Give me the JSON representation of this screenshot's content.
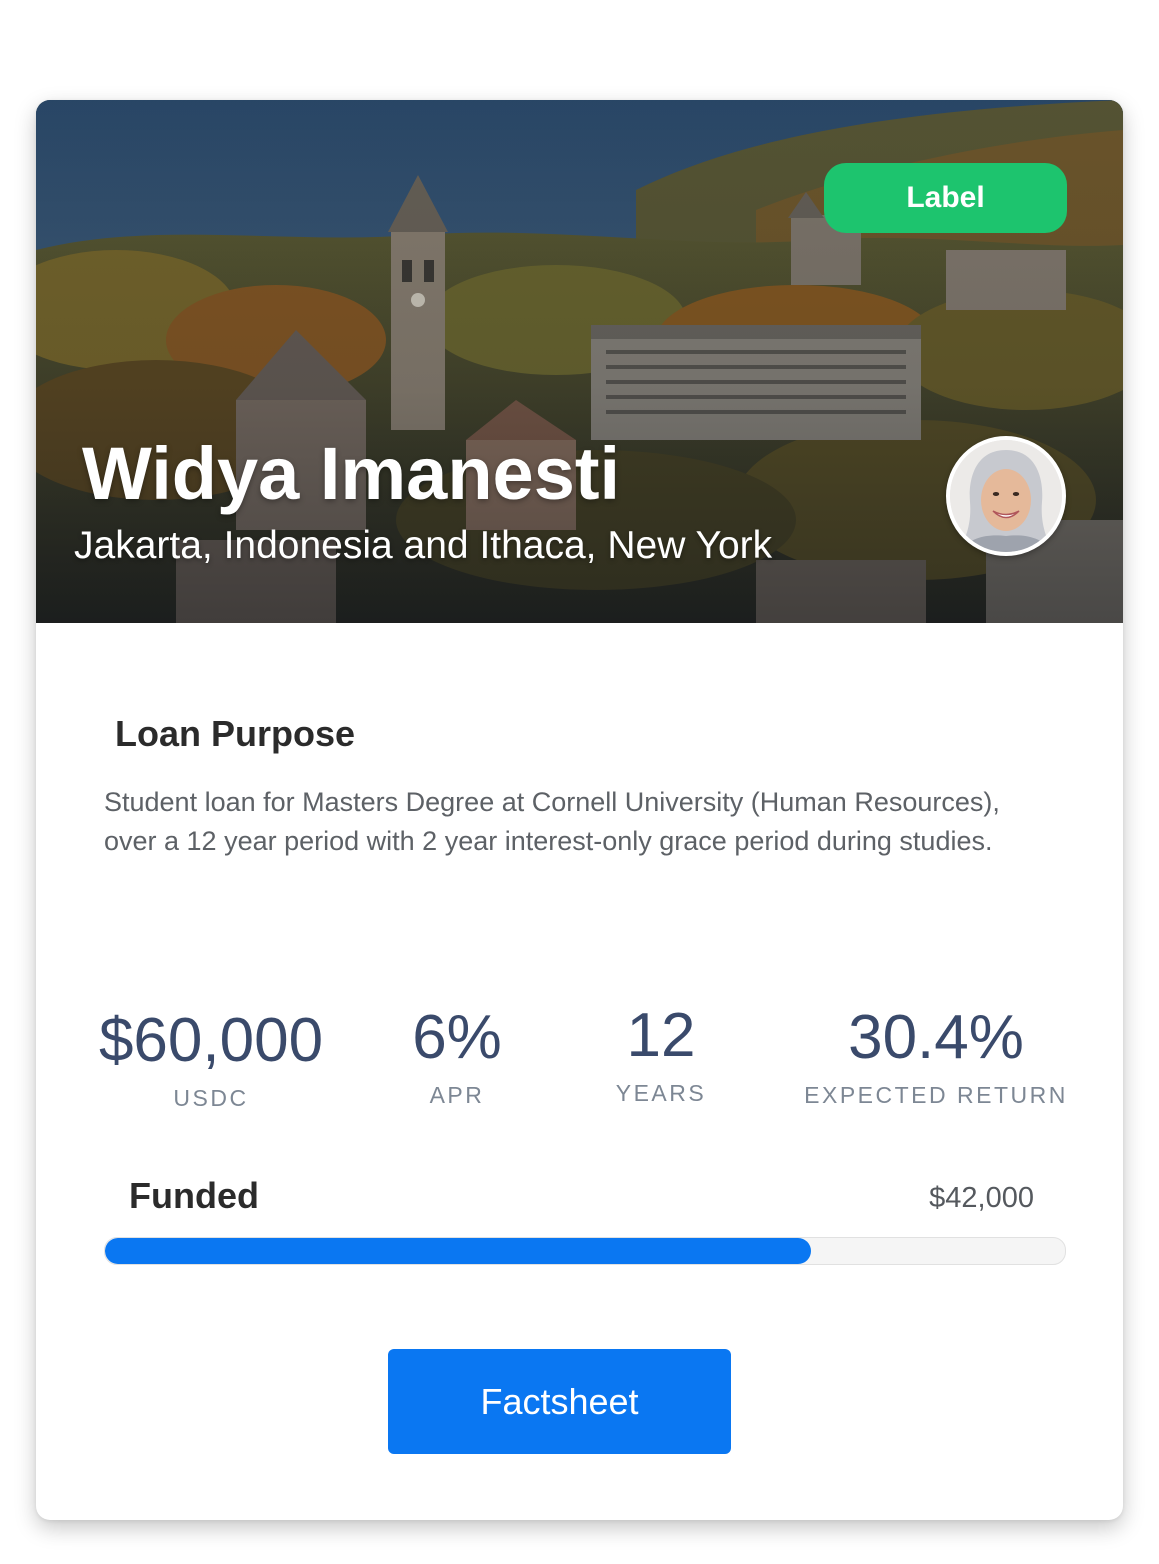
{
  "card": {
    "badge_label": "Label",
    "borrower_name": "Widya Imanesti",
    "borrower_location": "Jakarta, Indonesia and Ithaca, New York",
    "avatar_icon": "person-avatar-icon",
    "hero_image": "university-campus-photo"
  },
  "loan": {
    "purpose_title": "Loan Purpose",
    "purpose_text": "Student loan for Masters Degree at Cornell University (Human Resources), over a 12 year period with 2 year interest-only grace period during studies."
  },
  "stats": [
    {
      "value": "$60,000",
      "label": "USDC"
    },
    {
      "value": "6%",
      "label": "APR"
    },
    {
      "value": "12",
      "label": "YEARS"
    },
    {
      "value": "30.4%",
      "label": "EXPECTED RETURN"
    }
  ],
  "funding": {
    "label": "Funded",
    "amount": "$42,000",
    "progress_fraction": 0.735
  },
  "actions": {
    "factsheet_label": "Factsheet"
  },
  "colors": {
    "accent": "#0a77f2",
    "badge": "#1dc46e",
    "stat_value": "#3a4a6b"
  }
}
